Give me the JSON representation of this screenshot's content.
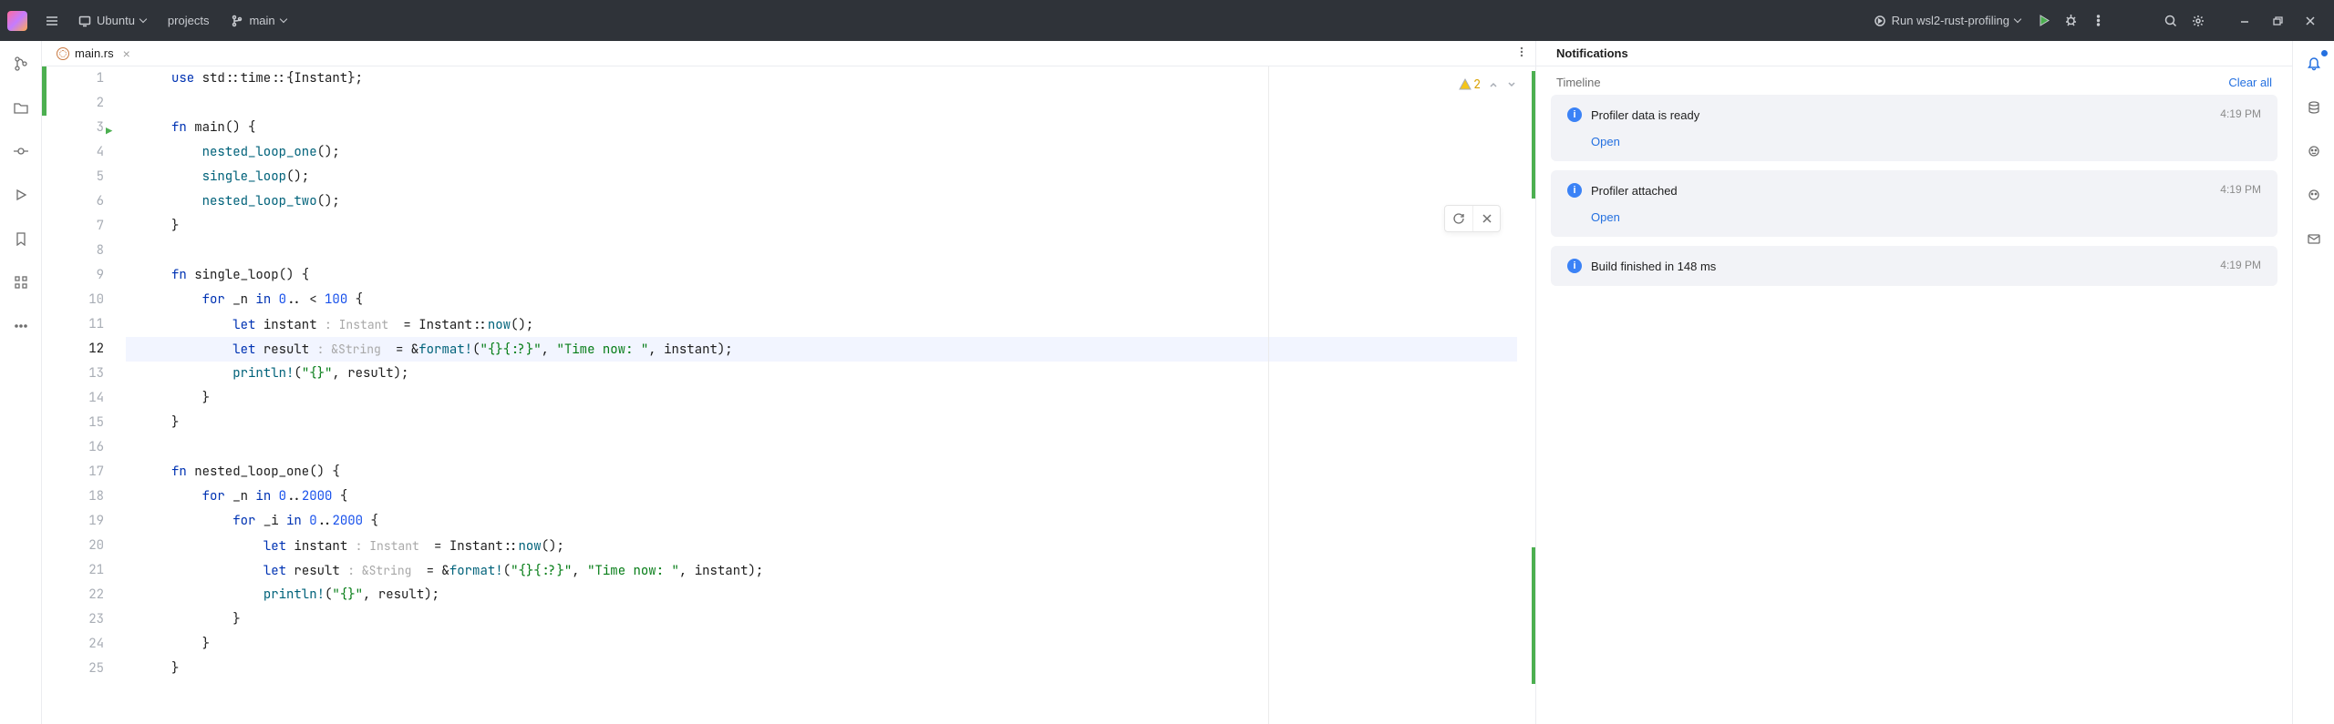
{
  "titlebar": {
    "os": "Ubuntu",
    "project": "projects",
    "branch": "main",
    "run_config": "Run wsl2-rust-profiling"
  },
  "tab": {
    "filename": "main.rs"
  },
  "inspection": {
    "warn_count": "2"
  },
  "code": {
    "lines": [
      {
        "n": "1",
        "seg": [
          [
            "kw",
            "use "
          ],
          [
            "op",
            "std::time::{Instant};"
          ]
        ]
      },
      {
        "n": "2",
        "seg": []
      },
      {
        "n": "3",
        "seg": [
          [
            "kw",
            "fn "
          ],
          [
            "fn-name",
            "main"
          ],
          [
            "op",
            "() {"
          ]
        ],
        "play": true
      },
      {
        "n": "4",
        "seg": [
          [
            "op",
            "    "
          ],
          [
            "fn-call",
            "nested_loop_one"
          ],
          [
            "op",
            "();"
          ]
        ]
      },
      {
        "n": "5",
        "seg": [
          [
            "op",
            "    "
          ],
          [
            "fn-call",
            "single_loop"
          ],
          [
            "op",
            "();"
          ]
        ]
      },
      {
        "n": "6",
        "seg": [
          [
            "op",
            "    "
          ],
          [
            "fn-call",
            "nested_loop_two"
          ],
          [
            "op",
            "();"
          ]
        ]
      },
      {
        "n": "7",
        "seg": [
          [
            "op",
            "}"
          ]
        ]
      },
      {
        "n": "8",
        "seg": []
      },
      {
        "n": "9",
        "seg": [
          [
            "kw",
            "fn "
          ],
          [
            "fn-name",
            "single_loop"
          ],
          [
            "op",
            "() {"
          ]
        ]
      },
      {
        "n": "10",
        "seg": [
          [
            "op",
            "    "
          ],
          [
            "kw",
            "for "
          ],
          [
            "op",
            "_n "
          ],
          [
            "kw",
            "in "
          ],
          [
            "num",
            "0"
          ],
          [
            "op",
            ".. < "
          ],
          [
            "num",
            "100"
          ],
          [
            "op",
            " {"
          ]
        ]
      },
      {
        "n": "11",
        "seg": [
          [
            "op",
            "        "
          ],
          [
            "kw",
            "let "
          ],
          [
            "op",
            "instant "
          ],
          [
            "hint",
            ": Instant "
          ],
          [
            "op",
            " = Instant::"
          ],
          [
            "fn-call",
            "now"
          ],
          [
            "op",
            "();"
          ]
        ]
      },
      {
        "n": "12",
        "hl": true,
        "seg": [
          [
            "op",
            "        "
          ],
          [
            "kw",
            "let "
          ],
          [
            "op",
            "result "
          ],
          [
            "hint",
            ": &String "
          ],
          [
            "op",
            " = &"
          ],
          [
            "macro",
            "format!"
          ],
          [
            "op",
            "("
          ],
          [
            "str",
            "\"{}{:?}\""
          ],
          [
            "op",
            ", "
          ],
          [
            "str",
            "\"Time now: \""
          ],
          [
            "op",
            ", instant);"
          ]
        ]
      },
      {
        "n": "13",
        "seg": [
          [
            "op",
            "        "
          ],
          [
            "macro",
            "println!"
          ],
          [
            "op",
            "("
          ],
          [
            "str",
            "\"{}\""
          ],
          [
            "op",
            ", result);"
          ]
        ]
      },
      {
        "n": "14",
        "seg": [
          [
            "op",
            "    }"
          ]
        ]
      },
      {
        "n": "15",
        "seg": [
          [
            "op",
            "}"
          ]
        ]
      },
      {
        "n": "16",
        "seg": []
      },
      {
        "n": "17",
        "seg": [
          [
            "kw",
            "fn "
          ],
          [
            "fn-name",
            "nested_loop_one"
          ],
          [
            "op",
            "() {"
          ]
        ]
      },
      {
        "n": "18",
        "seg": [
          [
            "op",
            "    "
          ],
          [
            "kw",
            "for "
          ],
          [
            "op",
            "_n "
          ],
          [
            "kw",
            "in "
          ],
          [
            "num",
            "0"
          ],
          [
            "op",
            ".."
          ],
          [
            "num",
            "2000"
          ],
          [
            "op",
            " {"
          ]
        ]
      },
      {
        "n": "19",
        "seg": [
          [
            "op",
            "        "
          ],
          [
            "kw",
            "for "
          ],
          [
            "op",
            "_i "
          ],
          [
            "kw",
            "in "
          ],
          [
            "num",
            "0"
          ],
          [
            "op",
            ".."
          ],
          [
            "num",
            "2000"
          ],
          [
            "op",
            " {"
          ]
        ]
      },
      {
        "n": "20",
        "seg": [
          [
            "op",
            "            "
          ],
          [
            "kw",
            "let "
          ],
          [
            "op",
            "instant "
          ],
          [
            "hint",
            ": Instant "
          ],
          [
            "op",
            " = Instant::"
          ],
          [
            "fn-call",
            "now"
          ],
          [
            "op",
            "();"
          ]
        ]
      },
      {
        "n": "21",
        "seg": [
          [
            "op",
            "            "
          ],
          [
            "kw",
            "let "
          ],
          [
            "op",
            "result "
          ],
          [
            "hint",
            ": &String "
          ],
          [
            "op",
            " = &"
          ],
          [
            "macro",
            "format!"
          ],
          [
            "op",
            "("
          ],
          [
            "str",
            "\"{}{:?}\""
          ],
          [
            "op",
            ", "
          ],
          [
            "str",
            "\"Time now: \""
          ],
          [
            "op",
            ", instant);"
          ]
        ]
      },
      {
        "n": "22",
        "seg": [
          [
            "op",
            "            "
          ],
          [
            "macro",
            "println!"
          ],
          [
            "op",
            "("
          ],
          [
            "str",
            "\"{}\""
          ],
          [
            "op",
            ", result);"
          ]
        ]
      },
      {
        "n": "23",
        "seg": [
          [
            "op",
            "        }"
          ]
        ]
      },
      {
        "n": "24",
        "seg": [
          [
            "op",
            "    }"
          ]
        ]
      },
      {
        "n": "25",
        "seg": [
          [
            "op",
            "}"
          ]
        ]
      }
    ]
  },
  "notifications": {
    "heading": "Notifications",
    "timeline": "Timeline",
    "clear": "Clear all",
    "items": [
      {
        "title": "Profiler data is ready",
        "time": "4:19 PM",
        "link": "Open"
      },
      {
        "title": "Profiler attached",
        "time": "4:19 PM",
        "link": "Open"
      },
      {
        "title": "Build finished in 148 ms",
        "time": "4:19 PM"
      }
    ]
  }
}
